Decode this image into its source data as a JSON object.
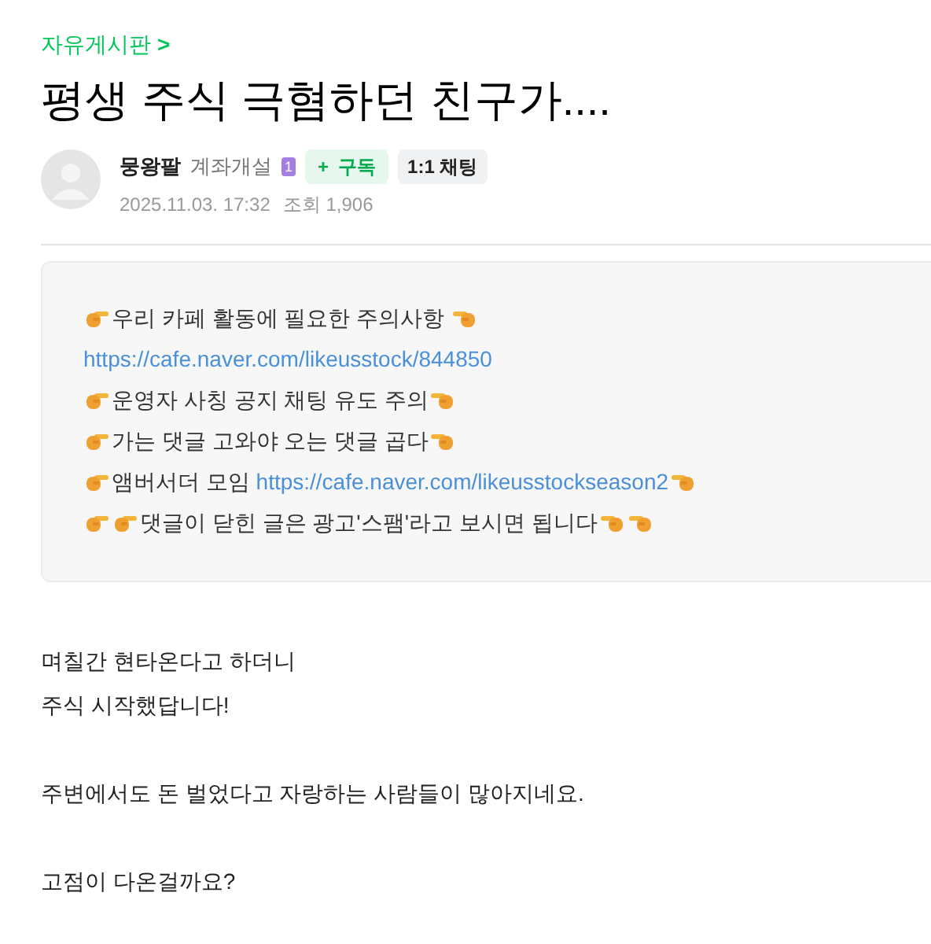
{
  "breadcrumb": {
    "label": "자유게시판",
    "arrow": ">"
  },
  "title": "평생 주식 극혐하던 친구가....",
  "author": {
    "name": "뭉왕팔",
    "rank": "계좌개설",
    "level_badge": "1",
    "subscribe": {
      "plus": "+",
      "label": "구독"
    },
    "chat": "1:1 채팅",
    "date": "2025.11.03. 17:32",
    "views_label": "조회",
    "views": "1,906"
  },
  "notice": [
    [
      {
        "kind": "point-right"
      },
      {
        "kind": "text",
        "text": "우리 카페 활동에 필요한 주의사항 "
      },
      {
        "kind": "point-left"
      }
    ],
    [
      {
        "kind": "link",
        "text": "https://cafe.naver.com/likeusstock/844850"
      }
    ],
    [
      {
        "kind": "point-right"
      },
      {
        "kind": "text",
        "text": "운영자 사칭 공지 채팅 유도 주의"
      },
      {
        "kind": "point-left"
      }
    ],
    [
      {
        "kind": "point-right"
      },
      {
        "kind": "text",
        "text": "가는 댓글 고와야 오는 댓글 곱다"
      },
      {
        "kind": "point-left"
      }
    ],
    [
      {
        "kind": "point-right"
      },
      {
        "kind": "text",
        "text": "앰버서더 모임 "
      },
      {
        "kind": "link",
        "text": "https://cafe.naver.com/likeusstockseason2"
      },
      {
        "kind": "point-left"
      }
    ],
    [
      {
        "kind": "point-right"
      },
      {
        "kind": "point-right"
      },
      {
        "kind": "text",
        "text": "댓글이 닫힌 글은 광고'스팸'라고 보시면 됩니다"
      },
      {
        "kind": "point-left"
      },
      {
        "kind": "point-left"
      }
    ]
  ],
  "body": [
    {
      "kind": "text",
      "text": "며칠간 현타온다고 하더니"
    },
    {
      "kind": "text",
      "text": "주식 시작했답니다!"
    },
    {
      "kind": "blank"
    },
    {
      "kind": "text",
      "text": "주변에서도 돈 벌었다고 자랑하는 사람들이 많아지네요."
    },
    {
      "kind": "blank"
    },
    {
      "kind": "text",
      "text": "고점이 다온걸까요?"
    }
  ]
}
